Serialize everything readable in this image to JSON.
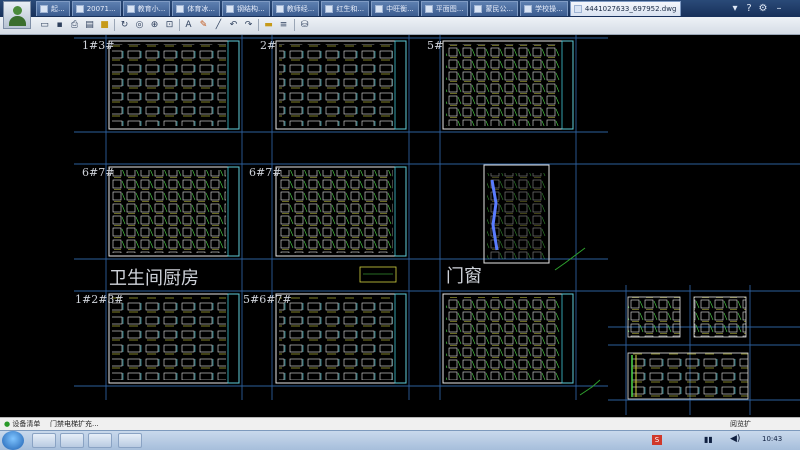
{
  "window": {
    "tabs": [
      {
        "label": "起...",
        "active": false
      },
      {
        "label": "20071...",
        "active": false
      },
      {
        "label": "教育小...",
        "active": false
      },
      {
        "label": "体育冰...",
        "active": false
      },
      {
        "label": "钢结构...",
        "active": false
      },
      {
        "label": "教师经...",
        "active": false
      },
      {
        "label": "红生和...",
        "active": false
      },
      {
        "label": "中旺衡...",
        "active": false
      },
      {
        "label": "平面图...",
        "active": false
      },
      {
        "label": "蒙民公...",
        "active": false
      },
      {
        "label": "学校操...",
        "active": false
      },
      {
        "label": "4441027633_697952.dwg",
        "active": true
      }
    ],
    "controls": {
      "more": "▾",
      "help": "?",
      "settings": "⚙"
    }
  },
  "toolbar": {
    "icons": [
      "open-icon",
      "save-icon",
      "print-icon",
      "print-preview-icon",
      "lock-icon",
      "rotate-icon",
      "zoom-extents-icon",
      "zoom-in-icon",
      "zoom-window-icon",
      "pan-icon",
      "text-icon",
      "pencil-icon",
      "line-icon",
      "undo-icon",
      "redo-icon",
      "measure-icon",
      "layers-icon",
      "block-icon"
    ]
  },
  "drawing": {
    "sheet_labels": {
      "r1c1": "1#3#",
      "r1c2": "2#",
      "r1c3": "5#",
      "r2c1": "6#7#",
      "r2c2": "6#7#",
      "r3c1": "1#2#3#",
      "r3c2": "5#6#7#"
    },
    "section_labels": {
      "bath_kitchen": "卫生间厨房",
      "doors_windows": "门窗"
    }
  },
  "statusbar": {
    "left_item_1": "设备清单",
    "left_item_2": "门禁电梯扩充...",
    "right_item": "阅览扩"
  },
  "taskbar": {
    "apps": [
      "folder-icon",
      "app-icon",
      "cad-icon",
      "paint-icon"
    ],
    "tray": [
      "ime-icon",
      "network-icon",
      "volume-icon"
    ],
    "clock": "10:43"
  }
}
